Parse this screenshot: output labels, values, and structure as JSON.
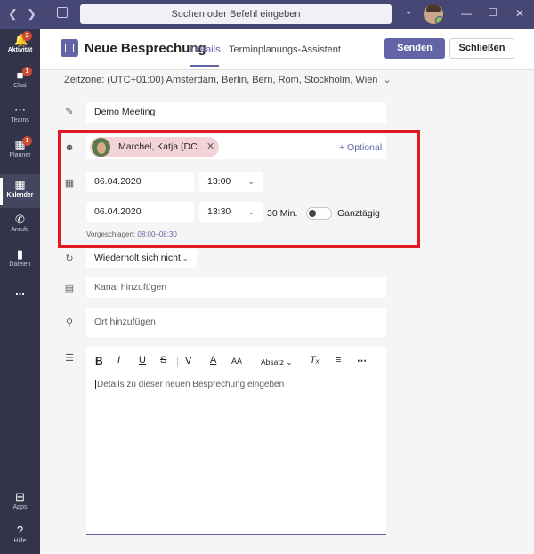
{
  "titlebar": {
    "search_placeholder": "Suchen oder Befehl eingeben",
    "back_icon": "chevron-left",
    "forward_icon": "chevron-right"
  },
  "rail": {
    "items": [
      {
        "label": "Aktivität",
        "icon": "bell-icon",
        "badge": "2"
      },
      {
        "label": "Chat",
        "icon": "chat-icon",
        "badge": "1"
      },
      {
        "label": "Teams",
        "icon": "teams-icon",
        "badge": ""
      },
      {
        "label": "Planner",
        "icon": "planner-icon",
        "badge": "1"
      },
      {
        "label": "Kalender",
        "icon": "calendar-icon",
        "badge": ""
      },
      {
        "label": "Anrufe",
        "icon": "phone-icon",
        "badge": ""
      },
      {
        "label": "Dateien",
        "icon": "files-icon",
        "badge": ""
      },
      {
        "label": "...",
        "icon": "more-icon",
        "badge": ""
      }
    ],
    "bottom": [
      {
        "label": "Apps",
        "icon": "apps-icon"
      },
      {
        "label": "Hilfe",
        "icon": "help-icon"
      }
    ]
  },
  "header": {
    "title": "Neue Besprechung",
    "tabs": [
      "Details",
      "Terminplanungs-Assistent"
    ],
    "send_label": "Senden",
    "close_label": "Schließen"
  },
  "timezone": "Zeitzone: (UTC+01:00) Amsterdam, Berlin, Bern, Rom, Stockholm, Wien",
  "form": {
    "title_value": "Demo Meeting",
    "attendee_name": "Marchel, Katja (DC...",
    "optional_label": "+ Optional",
    "start_date": "06.04.2020",
    "start_time": "13:00",
    "end_date": "06.04.2020",
    "end_time": "13:30",
    "duration": "30 Min.",
    "all_day_label": "Ganztägig",
    "suggested_label": "Vorgeschlagen:",
    "suggested_value": "08:00–08:30",
    "repeat_value": "Wiederholt sich nicht",
    "channel_placeholder": "Kanal hinzufügen",
    "location_placeholder": "Ort hinzufügen",
    "editor_placeholder": "Details zu dieser neuen Besprechung eingeben",
    "paragraph_label": "Absatz"
  },
  "colors": {
    "accent": "#6264a7",
    "titlebar": "#464775",
    "rail": "#33344a",
    "highlight": "#e11a22",
    "badge": "#cc4a31"
  }
}
